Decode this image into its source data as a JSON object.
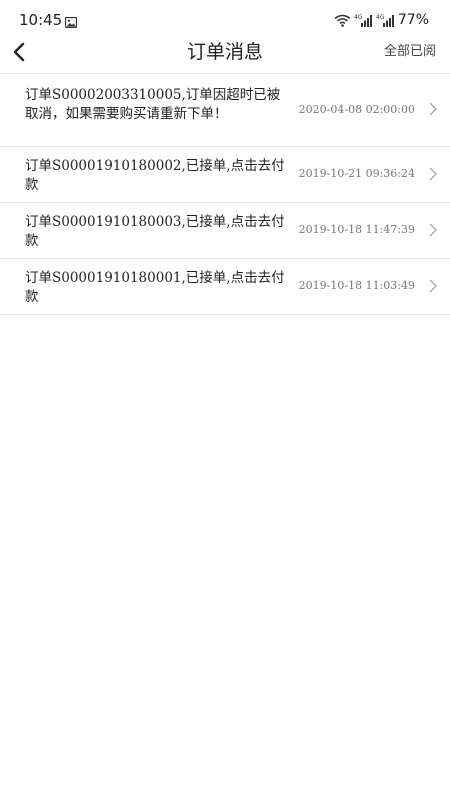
{
  "status_bar": {
    "time": "10:45",
    "network_1": "4G",
    "network_2": "4G",
    "battery": "77%"
  },
  "nav": {
    "title": "订单消息",
    "mark_all_read": "全部已阅"
  },
  "messages": [
    {
      "text": "订单S00002003310005,订单因超时已被取消，如果需要购买请重新下单！",
      "time": "2020-04-08 02:00:00"
    },
    {
      "text": "订单S00001910180002,已接单,点击去付款",
      "time": "2019-10-21 09:36:24"
    },
    {
      "text": "订单S00001910180003,已接单,点击去付款",
      "time": "2019-10-18 11:47:39"
    },
    {
      "text": "订单S00001910180001,已接单,点击去付款",
      "time": "2019-10-18 11:03:49"
    }
  ]
}
